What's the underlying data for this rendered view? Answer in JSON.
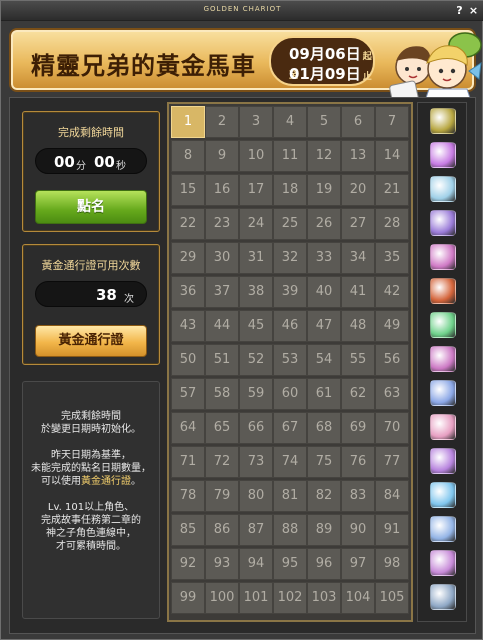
{
  "window": {
    "title": "GOLDEN CHARIOT",
    "help_label": "?",
    "close_label": "×"
  },
  "banner": {
    "title": "精靈兄弟的黃金馬車",
    "start_date": "09月06日",
    "start_suffix": "起至",
    "end_date": "01月09日",
    "end_suffix": "止"
  },
  "timer": {
    "label": "完成剩餘時間",
    "minutes": "00",
    "minutes_unit": "分",
    "seconds": "00",
    "seconds_unit": "秒",
    "checkin_button": "點名"
  },
  "pass": {
    "label": "黃金通行證可用次數",
    "count": "38",
    "count_unit": "次",
    "button": "黃金通行證"
  },
  "info": {
    "lines_1": [
      "完成剩餘時間",
      "於變更日期時初始化。"
    ],
    "lines_2_a": "昨天日期為基準，",
    "lines_2_b": "未能完成的點名日期數量，",
    "lines_2_c_pre": "可以使用",
    "lines_2_c_hl": "黃金通行證",
    "lines_2_c_post": "。",
    "lines_3": [
      "Lv. 101以上角色、",
      "完成故事任務第二章的",
      "神之子角色連線中，",
      "才可累積時間。"
    ]
  },
  "grid": {
    "days": [
      1,
      2,
      3,
      4,
      5,
      6,
      7,
      8,
      9,
      10,
      11,
      12,
      13,
      14,
      15,
      16,
      17,
      18,
      19,
      20,
      21,
      22,
      23,
      24,
      25,
      26,
      27,
      28,
      29,
      30,
      31,
      32,
      33,
      34,
      35,
      36,
      37,
      38,
      39,
      40,
      41,
      42,
      43,
      44,
      45,
      46,
      47,
      48,
      49,
      50,
      51,
      52,
      53,
      54,
      55,
      56,
      57,
      58,
      59,
      60,
      61,
      62,
      63,
      64,
      65,
      66,
      67,
      68,
      69,
      70,
      71,
      72,
      73,
      74,
      75,
      76,
      77,
      78,
      79,
      80,
      81,
      82,
      83,
      84,
      85,
      86,
      87,
      88,
      89,
      90,
      91,
      92,
      93,
      94,
      95,
      96,
      97,
      98,
      99,
      100,
      101,
      102,
      103,
      104,
      105
    ],
    "completed_days": [
      1
    ]
  },
  "rewards": {
    "icons": [
      "box-icon",
      "ticket-icon",
      "coupon-icon",
      "card-icon",
      "wand-icon",
      "giftbox-icon",
      "potion-icon",
      "wand-icon",
      "card-icon",
      "coupon-icon",
      "wand-icon",
      "scroll-icon",
      "card-icon",
      "wand-icon",
      "scroll-icon"
    ],
    "colors": [
      "#b7a640",
      "#c77be3",
      "#9fd0e8",
      "#9a7bd8",
      "#d07ac6",
      "#d4643a",
      "#6ed18a",
      "#cc79c4",
      "#8ba7e6",
      "#e79fc2",
      "#b783de",
      "#7fc6ee",
      "#93b4e6",
      "#c78ad8",
      "#8fa8c6"
    ]
  },
  "colors": {
    "accent_gold": "#d8b766",
    "checkin_green": "#66a91c",
    "banner_brown": "#3d1f05"
  }
}
